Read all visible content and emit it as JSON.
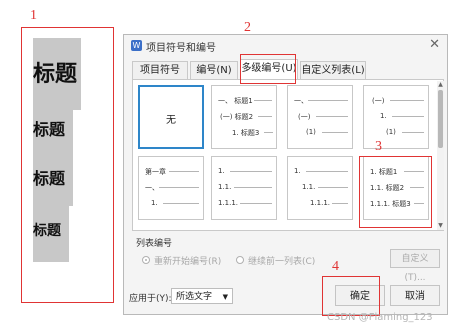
{
  "annotations": {
    "n1": "1",
    "n2": "2",
    "n3": "3",
    "n4": "4"
  },
  "headings": [
    "标题",
    "标题",
    "标题",
    "标题"
  ],
  "dialog": {
    "title": "项目符号和编号",
    "tabs": [
      "项目符号(B)",
      "编号(N)",
      "多级编号(U)",
      "自定义列表(L)"
    ],
    "active_tab": 2,
    "grid": {
      "none_label": "无",
      "cell1": [
        "一、 标题1",
        "(一) 标题2",
        "1. 标题3"
      ],
      "cell2": [
        "一、",
        "(一)",
        "(1)"
      ],
      "cell3": [
        "(一)",
        "1.",
        "(1)"
      ],
      "cell4": [
        "第一章",
        "一、",
        "1."
      ],
      "cell5": [
        "1.",
        "1.1.",
        "1.1.1."
      ],
      "cell6": [
        "1.",
        "1.1.",
        "1.1.1."
      ],
      "cell7": [
        "1. 标题1",
        "1.1. 标题2",
        "1.1.1. 标题3"
      ]
    },
    "list_numbering_label": "列表编号",
    "radio_restart": "重新开始编号(R)",
    "radio_continue": "继续前一列表(C)",
    "custom_button": "自定义(T)...",
    "apply_to_label": "应用于(Y):",
    "apply_to_value": "所选文字",
    "ok_button": "确定",
    "cancel_button": "取消"
  },
  "watermark": "CSDN @Flaming_123",
  "colors": {
    "annotation_red": "#e03434",
    "selection_blue": "#2e86c9"
  }
}
